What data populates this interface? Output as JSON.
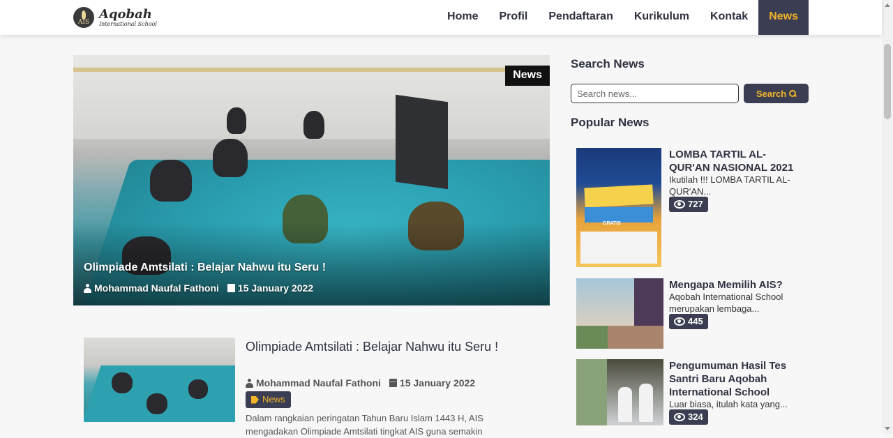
{
  "brand": {
    "title": "Aqobah",
    "subtitle": "International School",
    "mark": "AIS"
  },
  "nav": {
    "items": [
      {
        "label": "Home"
      },
      {
        "label": "Profil"
      },
      {
        "label": "Pendaftaran"
      },
      {
        "label": "Kurikulum"
      },
      {
        "label": "Kontak"
      },
      {
        "label": "News"
      }
    ],
    "active": "News",
    "accent_color": "#f0b429",
    "dark_color": "#3b3e52"
  },
  "hero": {
    "badge": "News",
    "title": "Olimpiade Amtsilati : Belajar Nahwu itu Seru !",
    "author": "Mohammad Naufal Fathoni",
    "date": "15 January 2022"
  },
  "article": {
    "title": "Olimpiade Amtsilati : Belajar Nahwu itu Seru !",
    "author": "Mohammad Naufal Fathoni",
    "date": "15 January 2022",
    "tag": "News",
    "excerpt": "Dalam rangkaian peringatan Tahun Baru Islam 1443 H, AIS mengadakan Olimpiade Amtsilati tingkat AIS guna semakin"
  },
  "sidebar": {
    "search_heading": "Search News",
    "search_placeholder": "Search news...",
    "search_button": "Search",
    "popular_heading": "Popular News",
    "popular": [
      {
        "title": "LOMBA TARTIL AL-QUR'AN NASIONAL 2021",
        "excerpt": "Ikutilah !!! LOMBA TARTIL AL-QUR'AN...",
        "views": "727"
      },
      {
        "title": "Mengapa Memilih AIS?",
        "excerpt": "Aqobah International School merupakan lembaga...",
        "views": "445"
      },
      {
        "title": "Pengumuman Hasil Tes Santri Baru Aqobah International School",
        "excerpt": "Luar biasa, itulah kata yang...",
        "views": "324"
      }
    ]
  },
  "poster1_text": {
    "band": "LOMBA TARTIL AL-QUR'AN",
    "gratis": "GRATIS"
  },
  "icons": {
    "user": "user-icon",
    "calendar": "calendar-icon",
    "tag": "tag-icon",
    "search": "search-icon",
    "views": "eye-icon"
  }
}
